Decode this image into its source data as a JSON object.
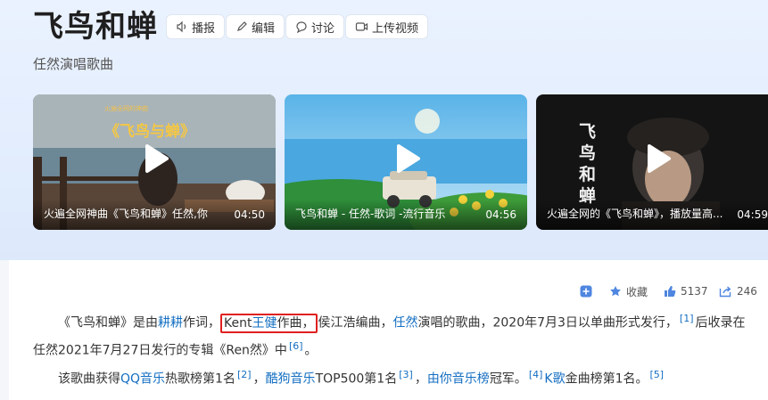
{
  "header": {
    "title": "飞鸟和蝉",
    "subtitle": "任然演唱歌曲",
    "actions": [
      {
        "label": "播报",
        "icon": "speaker-icon"
      },
      {
        "label": "编辑",
        "icon": "pencil-icon"
      },
      {
        "label": "讨论",
        "icon": "chat-icon"
      },
      {
        "label": "上传视频",
        "icon": "video-upload-icon"
      }
    ]
  },
  "videos": [
    {
      "title": "火遍全网神曲《飞鸟和蝉》任然,你",
      "duration": "04:50",
      "thumb_overlay": "《飞鸟与蝉》"
    },
    {
      "title": "飞鸟和蝉 - 任然-歌词 -流行音乐",
      "duration": "04:56"
    },
    {
      "title": "火遍全网的《飞鸟和蝉》，播放量高...",
      "duration": "04:59",
      "thumb_overlay": "飞鸟和蝉"
    }
  ],
  "toolbar": {
    "favorite_label": "收藏",
    "like_count": "5137",
    "share_count": "246"
  },
  "article": {
    "p1": {
      "t1": "《飞鸟和蝉》是由",
      "lyricist": "耕耕",
      "t2": "作词，",
      "composer_prefix": "Kent",
      "composer": "王健",
      "t3": "作曲，",
      "t4": "侯江浩编曲，",
      "singer": "任然",
      "t5": "演唱的歌曲，2020年7月3日以单曲形式发行，",
      "ref1": "[1]",
      "t6": "后收录在任然2021年7月27日发行的专辑《Ren然》中",
      "ref6": "[6]",
      "t7": "。"
    },
    "p2": {
      "t1": "该歌曲获得",
      "qq": "QQ音乐",
      "t2": "热歌榜第1名",
      "ref2": "[2]",
      "t3": "，",
      "kugou": "酷狗音乐",
      "t4": "TOP500第1名",
      "ref3": "[3]",
      "t5": "，",
      "nisheng": "由你音乐榜",
      "t6": "冠军。",
      "ref4": "[4]",
      "kge": "K歌",
      "t7": "金曲榜第1名。",
      "ref5": "[5]"
    }
  }
}
